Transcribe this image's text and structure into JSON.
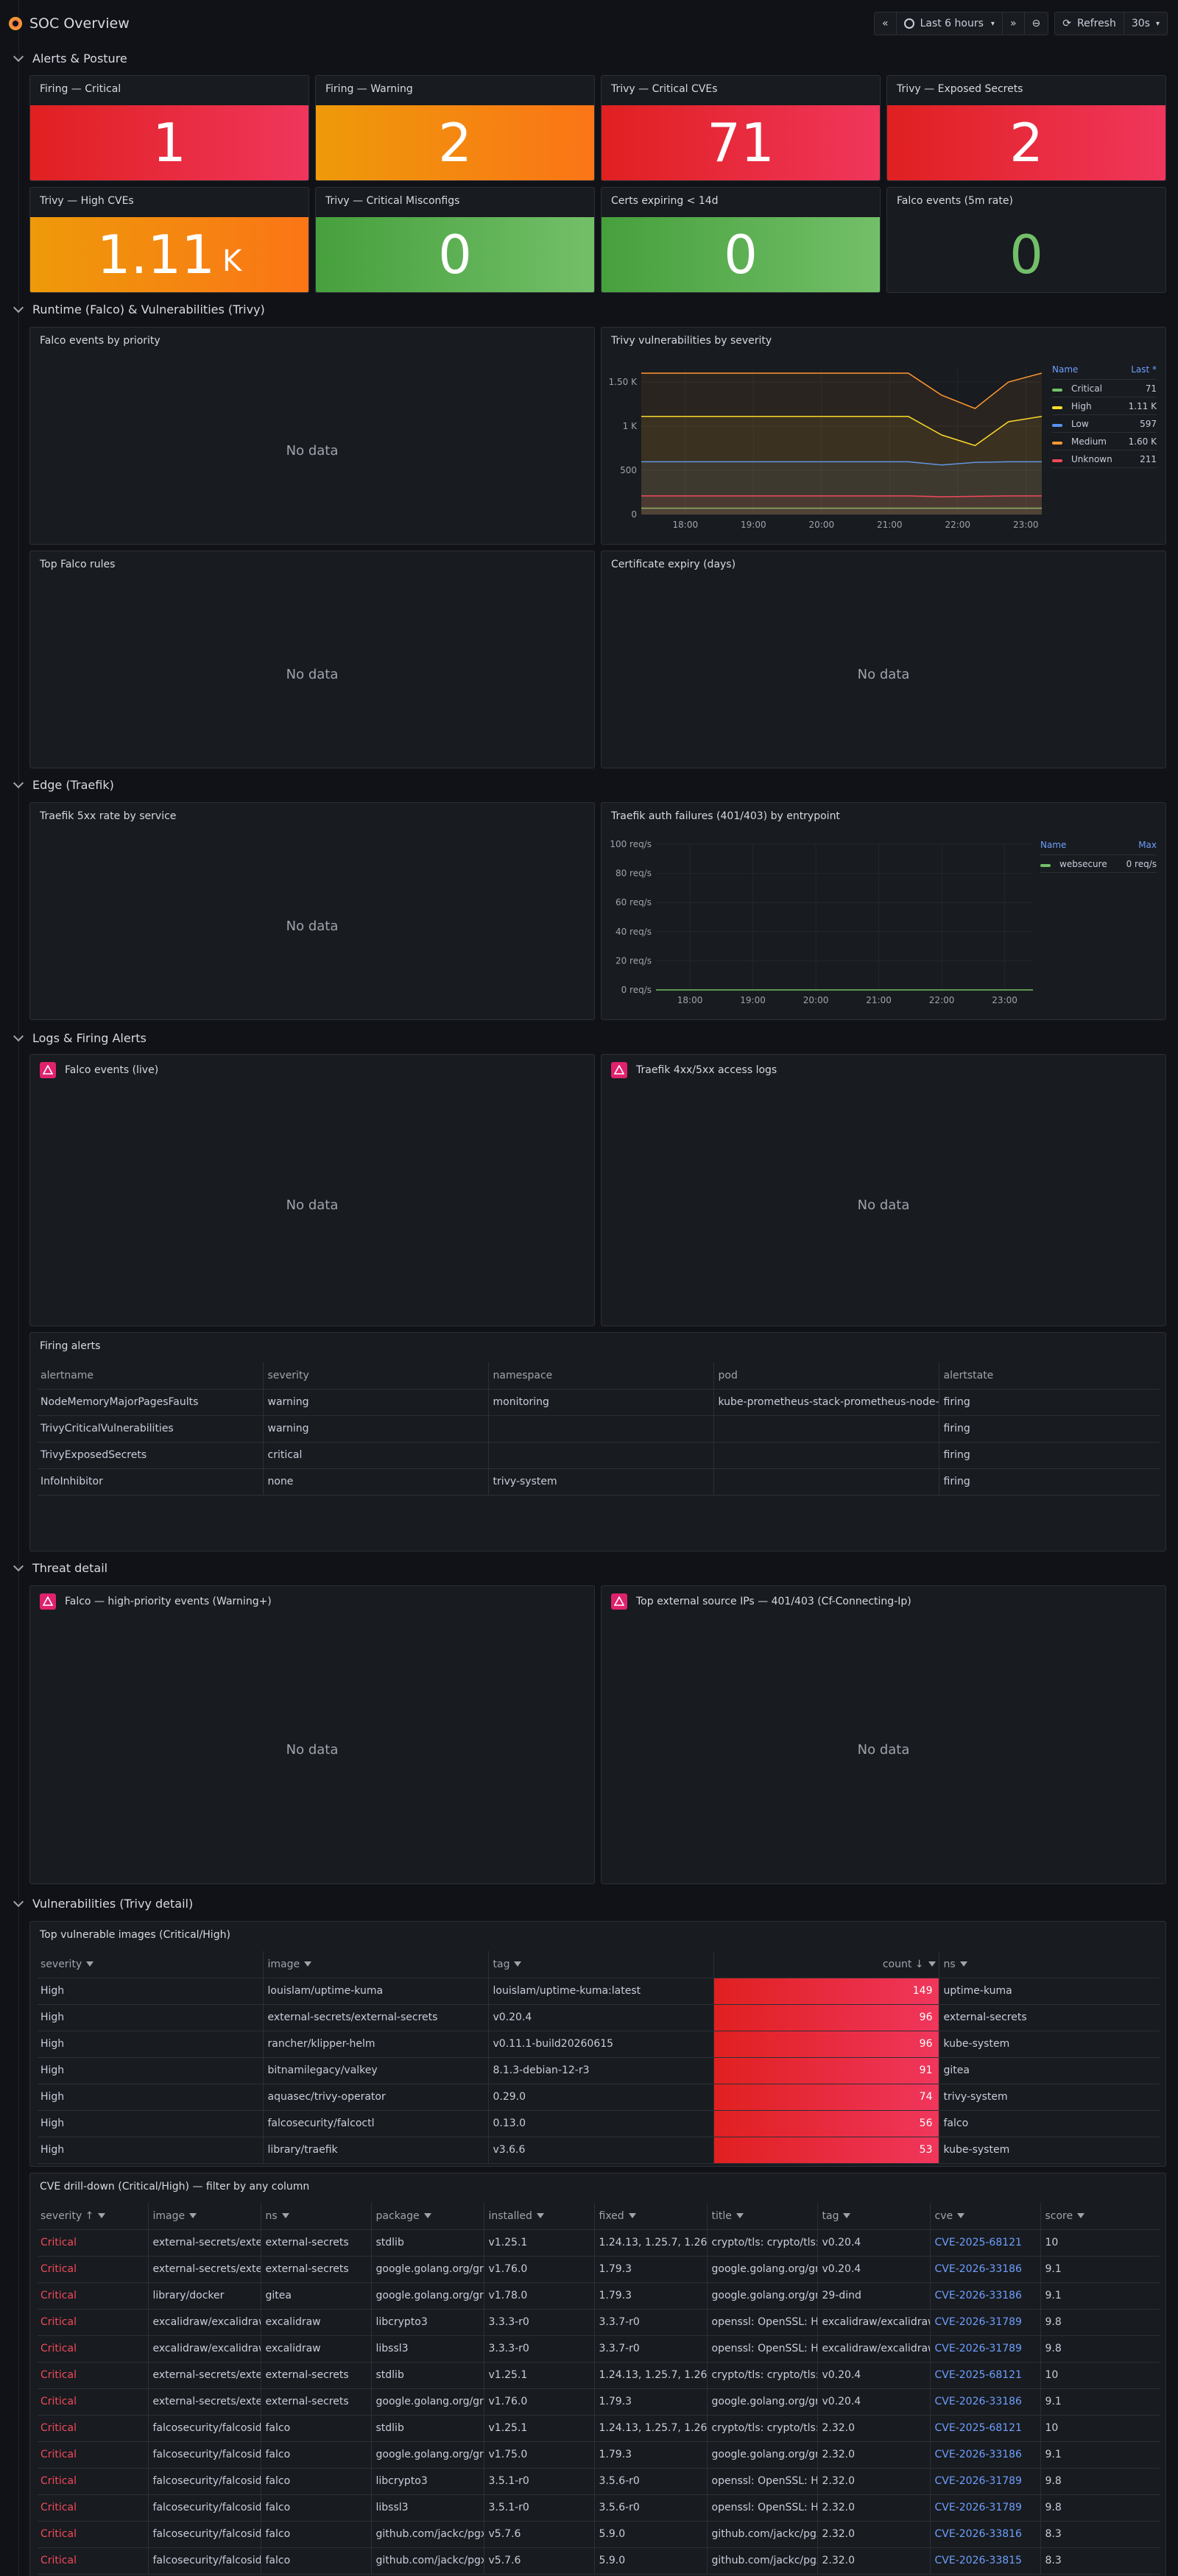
{
  "app": {
    "title": "SOC Overview"
  },
  "toolbar": {
    "time_range": "Last 6 hours",
    "refresh": "Refresh",
    "interval": "30s"
  },
  "rows": {
    "alerts": "Alerts & Posture",
    "runtime": "Runtime (Falco) & Vulnerabilities (Trivy)",
    "edge": "Edge (Traefik)",
    "logs": "Logs & Firing Alerts",
    "threat": "Threat detail",
    "vulns": "Vulnerabilities (Trivy detail)"
  },
  "stats": [
    {
      "title": "Firing — Critical",
      "value": "1",
      "unit": "",
      "color": "#e02f44"
    },
    {
      "title": "Firing — Warning",
      "value": "2",
      "unit": "",
      "color": "#ff9830"
    },
    {
      "title": "Trivy — Critical CVEs",
      "value": "71",
      "unit": "",
      "color": "#e02f44"
    },
    {
      "title": "Trivy — Exposed Secrets",
      "value": "2",
      "unit": "",
      "color": "#e02f44"
    },
    {
      "title": "Trivy — High CVEs",
      "value": "1.11",
      "unit": "K",
      "color": "#ff9830"
    },
    {
      "title": "Trivy — Critical Misconfigs",
      "value": "0",
      "unit": "",
      "color": "#73bf69"
    },
    {
      "title": "Certs expiring < 14d",
      "value": "0",
      "unit": "",
      "color": "#73bf69"
    },
    {
      "title": "Falco events (5m rate)",
      "value": "0",
      "unit": "",
      "color": "#73bf69"
    }
  ],
  "panels": {
    "falco_priority": "Falco events by priority",
    "trivy_severity": "Trivy vulnerabilities by severity",
    "top_falco_rules": "Top Falco rules",
    "cert_expiry": "Certificate expiry (days)",
    "traefik_5xx": "Traefik 5xx rate by service",
    "traefik_auth": "Traefik auth failures (401/403) by entrypoint",
    "falco_live": "Falco events (live)",
    "traefik_logs": "Traefik 4xx/5xx access logs",
    "firing_alerts": "Firing alerts",
    "falco_high": "Falco — high-priority events (Warning+)",
    "top_ips": "Top external source IPs — 401/403 (Cf-Connecting-Ip)",
    "top_images": "Top vulnerable images (Critical/High)",
    "cve_drill": "CVE drill-down (Critical/High) — filter by any column"
  },
  "no_data": "No data",
  "chart_data": [
    {
      "type": "line",
      "title": "Trivy vulnerabilities by severity",
      "x_ticks": [
        "18:00",
        "19:00",
        "20:00",
        "21:00",
        "22:00",
        "23:00"
      ],
      "y_ticks": [
        "0",
        "500",
        "1 K",
        "1.50 K"
      ],
      "ylim": [
        0,
        1650
      ],
      "legend": {
        "name_header": "Name",
        "value_header": "Last *"
      },
      "series": [
        {
          "name": "Critical",
          "last": "71",
          "color": "#73bf69",
          "values": [
            71,
            71,
            71,
            71,
            71,
            71,
            71,
            71,
            71,
            71,
            71,
            71,
            71
          ]
        },
        {
          "name": "High",
          "last": "1.11 K",
          "color": "#fade2a",
          "values": [
            1110,
            1110,
            1110,
            1110,
            1110,
            1110,
            1110,
            1110,
            1110,
            900,
            780,
            1050,
            1110
          ]
        },
        {
          "name": "Low",
          "last": "597",
          "color": "#5794f2",
          "values": [
            597,
            597,
            597,
            597,
            597,
            597,
            597,
            597,
            597,
            560,
            590,
            597,
            597
          ]
        },
        {
          "name": "Medium",
          "last": "1.60 K",
          "color": "#ff9830",
          "values": [
            1600,
            1600,
            1600,
            1600,
            1600,
            1600,
            1600,
            1600,
            1600,
            1350,
            1200,
            1500,
            1600
          ]
        },
        {
          "name": "Unknown",
          "last": "211",
          "color": "#f2495c",
          "values": [
            211,
            211,
            211,
            211,
            211,
            211,
            211,
            211,
            211,
            200,
            205,
            211,
            211
          ]
        }
      ]
    },
    {
      "type": "line",
      "title": "Traefik auth failures (401/403) by entrypoint",
      "x_ticks": [
        "18:00",
        "19:00",
        "20:00",
        "21:00",
        "22:00",
        "23:00"
      ],
      "y_ticks": [
        "0 req/s",
        "20 req/s",
        "40 req/s",
        "60 req/s",
        "80 req/s",
        "100 req/s"
      ],
      "ylim": [
        0,
        100
      ],
      "legend": {
        "name_header": "Name",
        "value_header": "Max"
      },
      "series": [
        {
          "name": "websecure",
          "max": "0 req/s",
          "color": "#73bf69",
          "values": [
            0,
            0,
            0,
            0,
            0,
            0,
            0
          ]
        }
      ]
    }
  ],
  "firing_table": {
    "columns": [
      "alertname",
      "severity",
      "namespace",
      "pod",
      "alertstate"
    ],
    "rows": [
      [
        "NodeMemoryMajorPagesFaults",
        "warning",
        "monitoring",
        "kube-prometheus-stack-prometheus-node-",
        "firing"
      ],
      [
        "TrivyCriticalVulnerabilities",
        "warning",
        "",
        "",
        "firing"
      ],
      [
        "TrivyExposedSecrets",
        "critical",
        "",
        "",
        "firing"
      ],
      [
        "InfoInhibitor",
        "none",
        "trivy-system",
        "",
        "firing"
      ]
    ]
  },
  "images_table": {
    "columns": [
      "severity",
      "image",
      "tag",
      "count ↓",
      "ns"
    ],
    "rows": [
      [
        "High",
        "louislam/uptime-kuma",
        "louislam/uptime-kuma:latest",
        "149",
        "uptime-kuma"
      ],
      [
        "High",
        "external-secrets/external-secrets",
        "v0.20.4",
        "96",
        "external-secrets"
      ],
      [
        "High",
        "rancher/klipper-helm",
        "v0.11.1-build20260615",
        "96",
        "kube-system"
      ],
      [
        "High",
        "bitnamilegacy/valkey",
        "8.1.3-debian-12-r3",
        "91",
        "gitea"
      ],
      [
        "High",
        "aquasec/trivy-operator",
        "0.29.0",
        "74",
        "trivy-system"
      ],
      [
        "High",
        "falcosecurity/falcoctl",
        "0.13.0",
        "56",
        "falco"
      ],
      [
        "High",
        "library/traefik",
        "v3.6.6",
        "53",
        "kube-system"
      ]
    ]
  },
  "cve_table": {
    "columns": [
      "severity ↑",
      "image",
      "ns",
      "package",
      "installed",
      "fixed",
      "title",
      "tag",
      "cve",
      "score"
    ],
    "rows": [
      [
        "Critical",
        "external-secrets/exte",
        "external-secrets",
        "stdlib",
        "v1.25.1",
        "1.24.13, 1.25.7, 1.26.0-",
        "crypto/tls: crypto/tls:",
        "v0.20.4",
        "CVE-2025-68121",
        "10"
      ],
      [
        "Critical",
        "external-secrets/exte",
        "external-secrets",
        "google.golang.org/grp",
        "v1.76.0",
        "1.79.3",
        "google.golang.org/grp",
        "v0.20.4",
        "CVE-2026-33186",
        "9.1"
      ],
      [
        "Critical",
        "library/docker",
        "gitea",
        "google.golang.org/grp",
        "v1.78.0",
        "1.79.3",
        "google.golang.org/grp",
        "29-dind",
        "CVE-2026-33186",
        "9.1"
      ],
      [
        "Critical",
        "excalidraw/excalidraw",
        "excalidraw",
        "libcrypto3",
        "3.3.3-r0",
        "3.3.7-r0",
        "openssl: OpenSSL: He",
        "excalidraw/excalidraw",
        "CVE-2026-31789",
        "9.8"
      ],
      [
        "Critical",
        "excalidraw/excalidraw",
        "excalidraw",
        "libssl3",
        "3.3.3-r0",
        "3.3.7-r0",
        "openssl: OpenSSL: He",
        "excalidraw/excalidraw",
        "CVE-2026-31789",
        "9.8"
      ],
      [
        "Critical",
        "external-secrets/exte",
        "external-secrets",
        "stdlib",
        "v1.25.1",
        "1.24.13, 1.25.7, 1.26.0-",
        "crypto/tls: crypto/tls:",
        "v0.20.4",
        "CVE-2025-68121",
        "10"
      ],
      [
        "Critical",
        "external-secrets/exte",
        "external-secrets",
        "google.golang.org/grp",
        "v1.76.0",
        "1.79.3",
        "google.golang.org/grp",
        "v0.20.4",
        "CVE-2026-33186",
        "9.1"
      ],
      [
        "Critical",
        "falcosecurity/falcosid",
        "falco",
        "stdlib",
        "v1.25.1",
        "1.24.13, 1.25.7, 1.26.0-",
        "crypto/tls: crypto/tls:",
        "2.32.0",
        "CVE-2025-68121",
        "10"
      ],
      [
        "Critical",
        "falcosecurity/falcosid",
        "falco",
        "google.golang.org/grp",
        "v1.75.0",
        "1.79.3",
        "google.golang.org/grp",
        "2.32.0",
        "CVE-2026-33186",
        "9.1"
      ],
      [
        "Critical",
        "falcosecurity/falcosid",
        "falco",
        "libcrypto3",
        "3.5.1-r0",
        "3.5.6-r0",
        "openssl: OpenSSL: He",
        "2.32.0",
        "CVE-2026-31789",
        "9.8"
      ],
      [
        "Critical",
        "falcosecurity/falcosid",
        "falco",
        "libssl3",
        "3.5.1-r0",
        "3.5.6-r0",
        "openssl: OpenSSL: He",
        "2.32.0",
        "CVE-2026-31789",
        "9.8"
      ],
      [
        "Critical",
        "falcosecurity/falcosid",
        "falco",
        "github.com/jackc/pgx",
        "v5.7.6",
        "5.9.0",
        "github.com/jackc/pgx",
        "2.32.0",
        "CVE-2026-33816",
        "8.3"
      ],
      [
        "Critical",
        "falcosecurity/falcosid",
        "falco",
        "github.com/jackc/pgx",
        "v5.7.6",
        "5.9.0",
        "github.com/jackc/pgx",
        "2.32.0",
        "CVE-2026-33815",
        "8.3"
      ]
    ]
  }
}
